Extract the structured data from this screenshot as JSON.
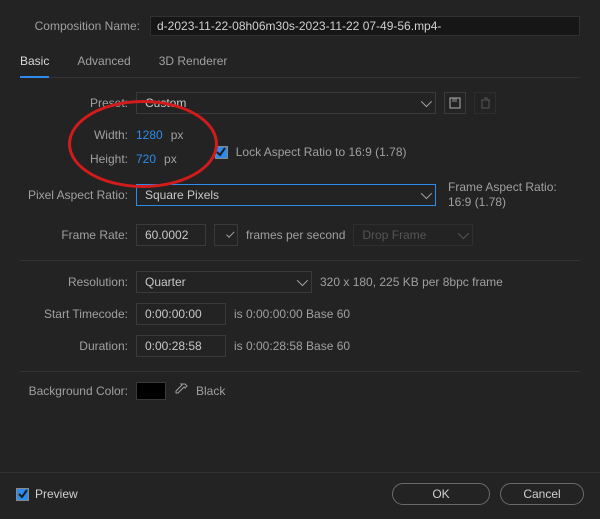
{
  "topRow": {
    "nameLabel": "Composition Name:",
    "nameValue": "d-2023-11-22-08h06m30s-2023-11-22 07-49-56.mp4-"
  },
  "tabs": {
    "basic": "Basic",
    "advanced": "Advanced",
    "renderer": "3D Renderer"
  },
  "preset": {
    "label": "Preset:",
    "value": "Custom"
  },
  "dims": {
    "widthLabel": "Width:",
    "widthValue": "1280",
    "pxW": "px",
    "heightLabel": "Height:",
    "heightValue": "720",
    "pxH": "px",
    "lockLabel": "Lock Aspect Ratio to 16:9 (1.78)"
  },
  "par": {
    "label": "Pixel Aspect Ratio:",
    "value": "Square Pixels",
    "frameLabel": "Frame Aspect Ratio:",
    "frameValue": "16:9 (1.78)"
  },
  "frameRate": {
    "label": "Frame Rate:",
    "value": "60.0002",
    "fps": "frames per second",
    "dropFrame": "Drop Frame"
  },
  "resolution": {
    "label": "Resolution:",
    "value": "Quarter",
    "hint": "320 x 180, 225 KB per 8bpc frame"
  },
  "startTC": {
    "label": "Start Timecode:",
    "value": "0:00:00:00",
    "hint": "is 0:00:00:00  Base 60"
  },
  "duration": {
    "label": "Duration:",
    "value": "0:00:28:58",
    "hint": "is 0:00:28:58  Base 60"
  },
  "bg": {
    "label": "Background Color:",
    "colorName": "Black",
    "swatchHex": "#000000"
  },
  "footer": {
    "preview": "Preview",
    "ok": "OK",
    "cancel": "Cancel"
  }
}
